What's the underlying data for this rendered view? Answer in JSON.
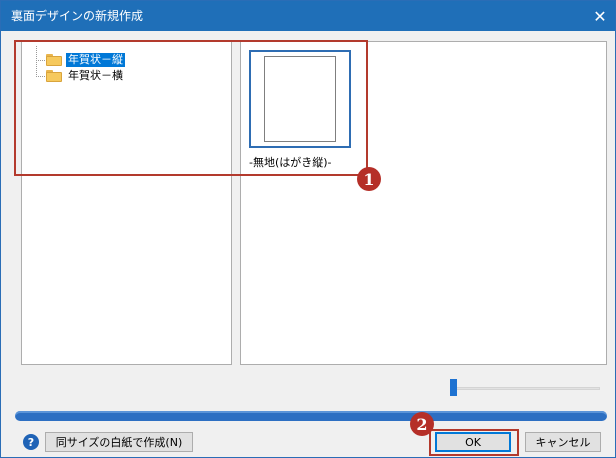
{
  "window": {
    "title": "裏面デザインの新規作成",
    "close_glyph": "✕"
  },
  "tree": {
    "items": [
      {
        "label": "年賀状－縦",
        "selected": true
      },
      {
        "label": "年賀状－横",
        "selected": false
      }
    ]
  },
  "preview": {
    "items": [
      {
        "label": "-無地(はがき縦)-",
        "selected": true
      }
    ]
  },
  "annotations": {
    "step1": "1",
    "step2": "2"
  },
  "zoom": {
    "slider_value": 0.03
  },
  "footer": {
    "help_glyph": "?",
    "blank_button_label": "同サイズの白紙で作成(N)",
    "ok_label": "OK",
    "cancel_label": "キャンセル"
  },
  "colors": {
    "titlebar": "#1f6fb8",
    "selection": "#0078d7",
    "annotation": "#b33a2d",
    "progress": "#2d6fc2"
  }
}
